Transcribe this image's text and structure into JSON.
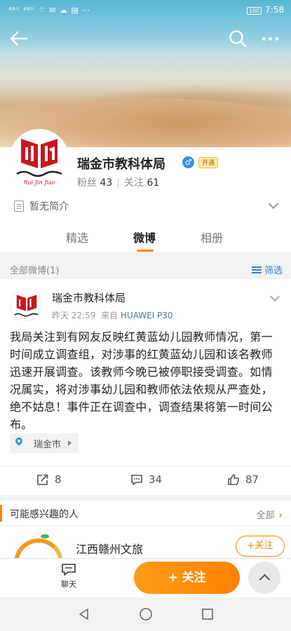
{
  "status_bar": {
    "left": "⁴⁶ᴵˡ ⁴⁶ᴵˡ ⌔ ✉ ☁ ▤ ⋯",
    "battery": "100",
    "time": "7:58"
  },
  "header": {
    "back_icon": "back-arrow-icon",
    "search_icon": "search-icon",
    "more_label": "···"
  },
  "profile": {
    "name": "瑞金市教科体局",
    "gender_symbol": "♂",
    "vip_label": "开通",
    "fans_label": "粉丝",
    "fans_count": "43",
    "following_label": "关注",
    "following_count": "61",
    "bio": "暂无简介",
    "avatar_caption": "Rui Jin Jiao"
  },
  "tabs": [
    {
      "label": "精选"
    },
    {
      "label": "微博",
      "active": true
    },
    {
      "label": "相册"
    }
  ],
  "section": {
    "title": "全部微博(1)",
    "filter_label": "筛选"
  },
  "post": {
    "author": "瑞金市教科体局",
    "time": "昨天 22:59",
    "source_prefix": "来自",
    "device": "HUAWEI P30",
    "text": "我局关注到有网友反映红黄蓝幼儿园教师情况，第一时间成立调查组，对涉事的红黄蓝幼儿园和该名教师迅速开展调查。该教师今晚已被停职接受调查。如情况属实，将对涉事幼儿园和教师依法依规从严查处，绝不姑息！事件正在调查中，调查结果将第一时间公布。",
    "location": "瑞金市",
    "reposts": "8",
    "comments": "34",
    "likes": "87"
  },
  "suggestions": {
    "title": "可能感兴趣的人",
    "all_label": "全部",
    "items": [
      {
        "name": "江西赣州文旅",
        "follow_label": "+关注"
      }
    ]
  },
  "bottom_bar": {
    "chat_label": "聊天",
    "follow_label": "+ 关注"
  },
  "colors": {
    "accent": "#ff8200",
    "link": "#3a7ec9",
    "logo_red": "#c8161d"
  }
}
